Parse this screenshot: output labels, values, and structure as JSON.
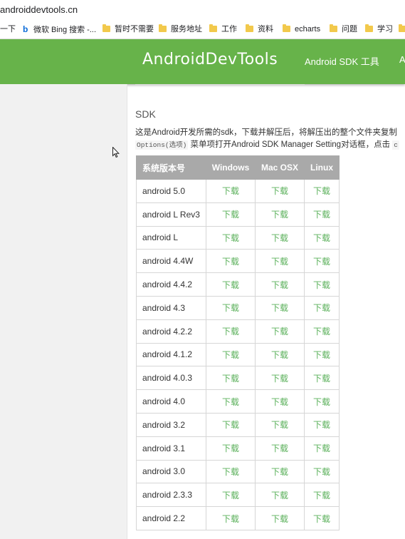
{
  "browser": {
    "address": "androiddevtools.cn",
    "bookmarks": [
      {
        "label": "一下",
        "icon": "none"
      },
      {
        "label": "微软 Bing 搜索 -...",
        "icon": "bing-icon"
      },
      {
        "label": "暂时不需要",
        "icon": "folder-icon"
      },
      {
        "label": "服务地址",
        "icon": "folder-icon"
      },
      {
        "label": "工作",
        "icon": "folder-icon"
      },
      {
        "label": "资料",
        "icon": "folder-icon"
      },
      {
        "label": "echarts",
        "icon": "folder-icon"
      },
      {
        "label": "问题",
        "icon": "folder-icon"
      },
      {
        "label": "学习",
        "icon": "folder-icon"
      }
    ]
  },
  "header": {
    "logo": "AndroidDevTools",
    "nav": [
      "Android SDK 工具",
      "A"
    ]
  },
  "content": {
    "section_title": "SDK",
    "desc_line1": "这是Android开发所需的sdk，下载并解压后，将解压出的整个文件夹复制",
    "desc_line2_code": "Options(选项)",
    "desc_line2_text": " 菜单项打开Android SDK Manager Setting对话框，点击 ",
    "desc_line2_tail": "c"
  },
  "table": {
    "headers": [
      "系统版本号",
      "Windows",
      "Mac OSX",
      "Linux"
    ],
    "download_label": "下载",
    "rows": [
      "android 5.0",
      "android L Rev3",
      "android L",
      "android 4.4W",
      "android 4.4.2",
      "android 4.3",
      "android 4.2.2",
      "android 4.1.2",
      "android 4.0.3",
      "android 4.0",
      "android 3.2",
      "android 3.1",
      "android 3.0",
      "android 2.3.3",
      "android 2.2"
    ]
  },
  "colors": {
    "header_green": "#67b34a",
    "link_green": "#5ab05a",
    "table_header_gray": "#a9a9a9"
  }
}
